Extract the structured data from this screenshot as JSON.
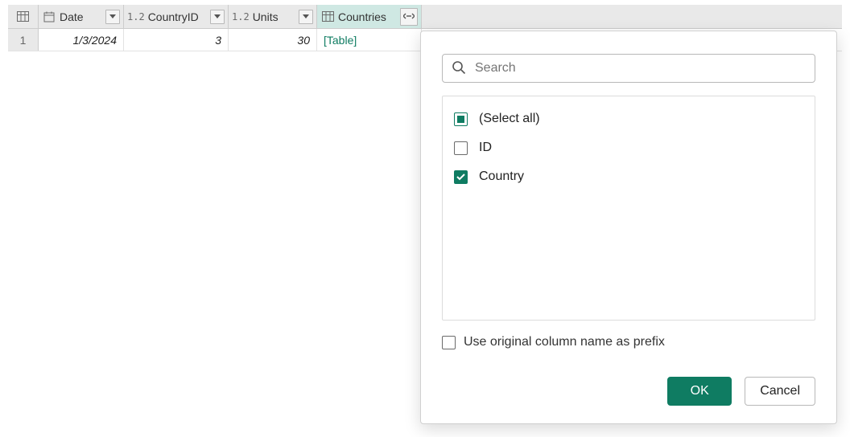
{
  "colors": {
    "accent": "#0f7c62",
    "header_active": "#cfe8e3"
  },
  "columns": {
    "date": {
      "label": "Date"
    },
    "countryid": {
      "label": "CountryID",
      "typetag": "1.2"
    },
    "units": {
      "label": "Units",
      "typetag": "1.2"
    },
    "countries": {
      "label": "Countries"
    }
  },
  "rows": [
    {
      "n": "1",
      "date": "1/3/2024",
      "countryid": "3",
      "units": "30",
      "countries_link": "[Table]"
    }
  ],
  "popup": {
    "search_placeholder": "Search",
    "options": {
      "select_all": {
        "label": "(Select all)",
        "state": "indeterminate"
      },
      "id": {
        "label": "ID",
        "state": "unchecked"
      },
      "country": {
        "label": "Country",
        "state": "checked"
      }
    },
    "prefix_label": "Use original column name as prefix",
    "prefix_checked": false,
    "ok_label": "OK",
    "cancel_label": "Cancel"
  }
}
